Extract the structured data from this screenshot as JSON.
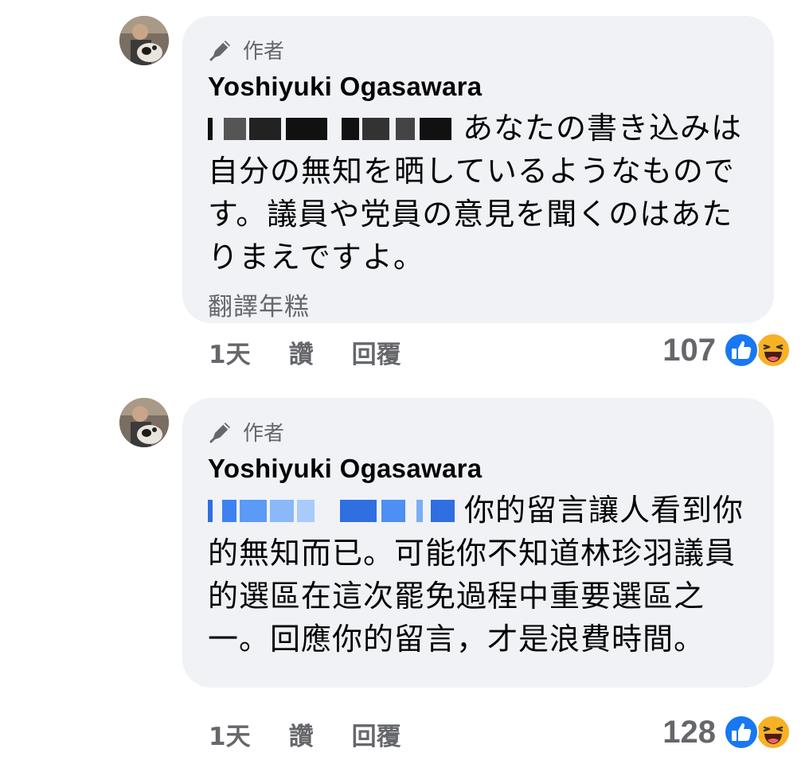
{
  "comments": [
    {
      "badge": "作者",
      "author": "Yoshiyuki Ogasawara",
      "text": "あなたの書き込みは自分の無知を晒しているようなものです。議員や党員の意見を聞くのはあたりまえですよ。",
      "translate": "翻譯年糕",
      "time": "1天",
      "like": "讚",
      "reply": "回覆",
      "reaction_count": "107",
      "redaction_color": "#111111"
    },
    {
      "badge": "作者",
      "author": "Yoshiyuki Ogasawara",
      "text": "你的留言讓人看到你的無知而已。可能你不知道林珍羽議員的選區在這次罷免過程中重要選區之一。回應你的留言，才是浪費時間。",
      "time": "1天",
      "like": "讚",
      "reply": "回覆",
      "reaction_count": "128",
      "redaction_color": "#2f6fe0"
    }
  ],
  "icons": {
    "badge": "pen-icon",
    "reaction_1": "like-icon",
    "reaction_2": "haha-icon"
  },
  "colors": {
    "bubble": "#f0f2f5",
    "secondary_text": "#65676b",
    "like_blue": "#1877f2",
    "haha_yellow": "#f7b125"
  }
}
